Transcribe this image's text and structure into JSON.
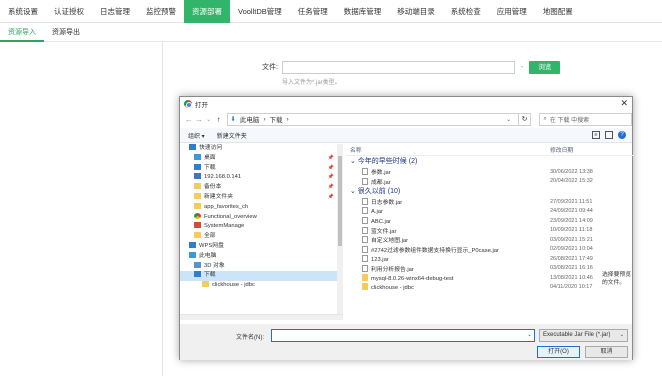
{
  "topnav": {
    "items": [
      "系统设置",
      "认证授权",
      "日志管理",
      "监控预警",
      "资源部署",
      "VoolltDB管理",
      "任务管理",
      "数据库管理",
      "移动端目录",
      "系统检查",
      "应用管理",
      "地图配置"
    ],
    "active_index": 4
  },
  "subnav": {
    "items": [
      "资源导入",
      "资源导出"
    ],
    "active_index": 0
  },
  "upload": {
    "label": "文件:",
    "dash": "-",
    "browse_label": "浏览",
    "hint": "导入文件为*.jar类型。"
  },
  "colors": {
    "accent": "#31b56a",
    "selection": "#cce4f7",
    "group_heading": "#1e3287"
  },
  "dialog": {
    "title": "打开",
    "close_glyph": "✕",
    "breadcrumb": [
      "此电脑",
      "›",
      "下载",
      "›"
    ],
    "search_placeholder": "在 下载 中搜索",
    "toolbar": {
      "organize": "组织 ▾",
      "new_folder": "新建文件夹"
    },
    "tree": [
      {
        "label": "快速访问",
        "icon": "star-icon",
        "level": "head"
      },
      {
        "label": "桌面",
        "icon": "desktop-icon",
        "pinned": true
      },
      {
        "label": "下载",
        "icon": "download-icon",
        "pinned": true
      },
      {
        "label": "192.168.0.141",
        "icon": "network-icon",
        "pinned": true
      },
      {
        "label": "备份本",
        "icon": "folder-icon",
        "pinned": true
      },
      {
        "label": "新建文件夹",
        "icon": "folder-icon",
        "pinned": true
      },
      {
        "label": "app_favorites_ch",
        "icon": "folder-icon"
      },
      {
        "label": "Functional_overview",
        "icon": "chrome-icon"
      },
      {
        "label": "SystemManage",
        "icon": "system-icon"
      },
      {
        "label": "全部",
        "icon": "folder-icon"
      },
      {
        "label": "WPS网盘",
        "icon": "cloud-icon",
        "level": "head"
      },
      {
        "label": "此电脑",
        "icon": "pc-icon",
        "level": "head"
      },
      {
        "label": "3D 对象",
        "icon": "cube-icon"
      },
      {
        "label": "下载",
        "icon": "download-icon",
        "selected": true
      },
      {
        "label": "clickhouse - jdbc",
        "icon": "folder-icon",
        "level": "indent2"
      }
    ],
    "columns": {
      "name": "名称",
      "modified": "修改日期"
    },
    "groups": [
      {
        "heading": "⌄ 今年的早些时候 (2)",
        "rows": [
          {
            "name": "参数.jar",
            "date": "30/06/2022 13:38",
            "type": "file"
          },
          {
            "name": "成都.jar",
            "date": "20/04/2022 15:32",
            "type": "file"
          }
        ]
      },
      {
        "heading": "⌄ 很久以前 (10)",
        "rows": [
          {
            "name": "日志参数.jar",
            "date": "27/09/2021 11:51",
            "type": "file"
          },
          {
            "name": "A.jar",
            "date": "24/09/2021 09:44",
            "type": "file"
          },
          {
            "name": "ABC.jar",
            "date": "23/09/2021 14:09",
            "type": "file"
          },
          {
            "name": "蓝文件.jar",
            "date": "10/09/2021 11:18",
            "type": "file"
          },
          {
            "name": "自定义地图.jar",
            "date": "03/09/2021 15:21",
            "type": "file"
          },
          {
            "name": "#2742过滤参数组件数据支持换行显示_P0case.jar",
            "date": "02/09/2021 10:04",
            "type": "file"
          },
          {
            "name": "123.jar",
            "date": "26/08/2021 17:49",
            "type": "file"
          },
          {
            "name": "利用分析报告.jar",
            "date": "03/08/2021 16:16",
            "type": "file"
          },
          {
            "name": "mysql-8.0.26-winx64-debug-test",
            "date": "13/08/2021 10:46",
            "type": "folder"
          },
          {
            "name": "clickhouse - jdbc",
            "date": "04/11/2020 10:17",
            "type": "folder"
          }
        ]
      }
    ],
    "preview_text": "选择要预览的文件。",
    "filename_label": "文件名(N):",
    "filename_value": "",
    "filetype": "Executable Jar File (*.jar)",
    "open_label": "打开(O)",
    "cancel_label": "取消"
  }
}
